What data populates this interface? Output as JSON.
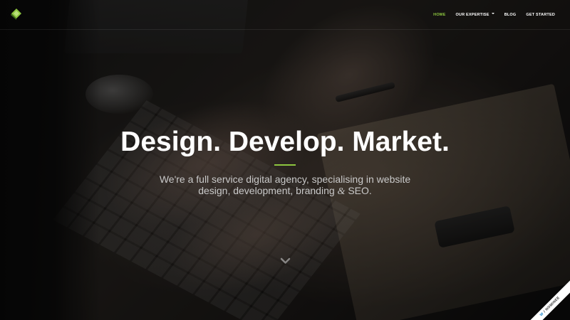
{
  "nav": {
    "items": [
      {
        "label": "HOME",
        "active": true
      },
      {
        "label": "OUR EXPERTISE",
        "has_dropdown": true
      },
      {
        "label": "BLOG"
      },
      {
        "label": "GET STARTED"
      }
    ]
  },
  "hero": {
    "headline": "Design. Develop. Market.",
    "subline_1": "We're a full service digital agency, specialising in website",
    "subline_2_pre": "design, development, branding ",
    "subline_amp": "&",
    "subline_2_post": " SEO."
  },
  "badge": {
    "brand": "W",
    "label": "NOMINEE"
  },
  "colors": {
    "accent": "#8dc63f",
    "nav_text": "#ffffff",
    "subline_text": "#c9c9c9",
    "logo_green": "#8dc63f",
    "logo_dark": "#3d6b1a"
  },
  "icons": {
    "logo": "diamond-logo-icon",
    "scroll": "chevron-down-icon",
    "dropdown": "caret-down-icon"
  }
}
